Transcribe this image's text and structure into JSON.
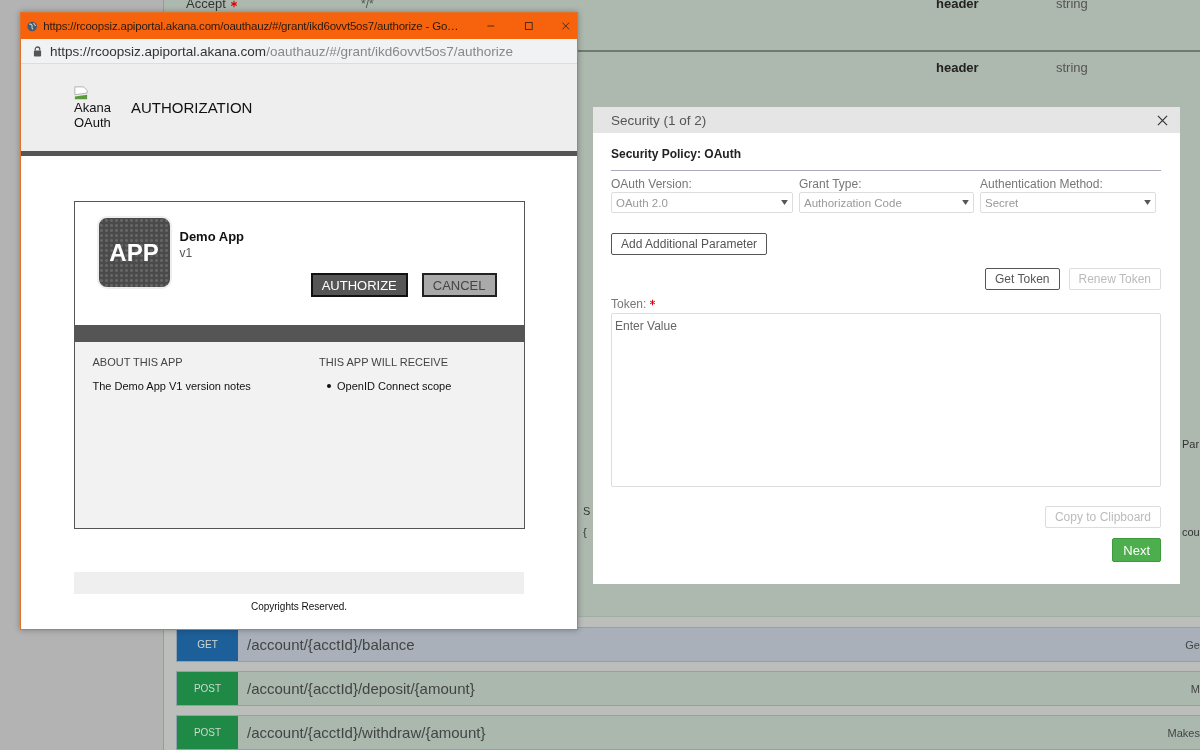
{
  "page": {
    "parameters": [
      {
        "name": "Accept",
        "required": true,
        "value": "*/*",
        "location": "header",
        "data_type": "string"
      },
      {
        "location": "header",
        "data_type": "string"
      }
    ],
    "fragments": [
      "Par",
      "S",
      "{",
      "cou"
    ],
    "endpoints": [
      {
        "method": "GET",
        "path": "/account/{acctId}/balance",
        "summary": "Ge"
      },
      {
        "method": "POST",
        "path": "/account/{acctId}/deposit/{amount}",
        "summary": "M"
      },
      {
        "method": "POST",
        "path": "/account/{acctId}/withdraw/{amount}",
        "summary": "Makes"
      }
    ]
  },
  "popup": {
    "title": "https://rcoopsiz.apiportal.akana.com/oauthauz/#/grant/ikd6ovvt5os7/authorize - Go…",
    "url_host": "https://rcoopsiz.apiportal.akana.com",
    "url_path": "/oauthauz/#/grant/ikd6ovvt5os7/authorize",
    "logo_alt": "Akana OAuth",
    "heading": "AUTHORIZATION",
    "app": {
      "icon_text": "APP",
      "name": "Demo App",
      "version": "v1"
    },
    "buttons": [
      "AUTHORIZE",
      "CANCEL"
    ],
    "about": {
      "title": "ABOUT THIS APP",
      "text": "The Demo App V1 version notes"
    },
    "receive": {
      "title": "THIS APP WILL RECEIVE",
      "items": [
        "OpenID Connect scope"
      ]
    },
    "footer": "Copyrights Reserved."
  },
  "dialog": {
    "title": "Security (1 of 2)",
    "policy": "Security Policy: OAuth",
    "selects": [
      {
        "label": "OAuth Version:",
        "value": "OAuth 2.0",
        "disabled": true
      },
      {
        "label": "Grant Type:",
        "value": "Authorization Code",
        "disabled": true
      },
      {
        "label": "Authentication Method:",
        "value": "Secret",
        "disabled": true
      }
    ],
    "add_param": "Add Additional Parameter",
    "token_buttons": [
      {
        "label": "Get Token",
        "disabled": false
      },
      {
        "label": "Renew Token",
        "disabled": true
      }
    ],
    "token": {
      "label": "Token:",
      "required": true,
      "placeholder": "Enter Value"
    },
    "copy": {
      "label": "Copy to Clipboard",
      "disabled": true
    },
    "next": "Next"
  }
}
